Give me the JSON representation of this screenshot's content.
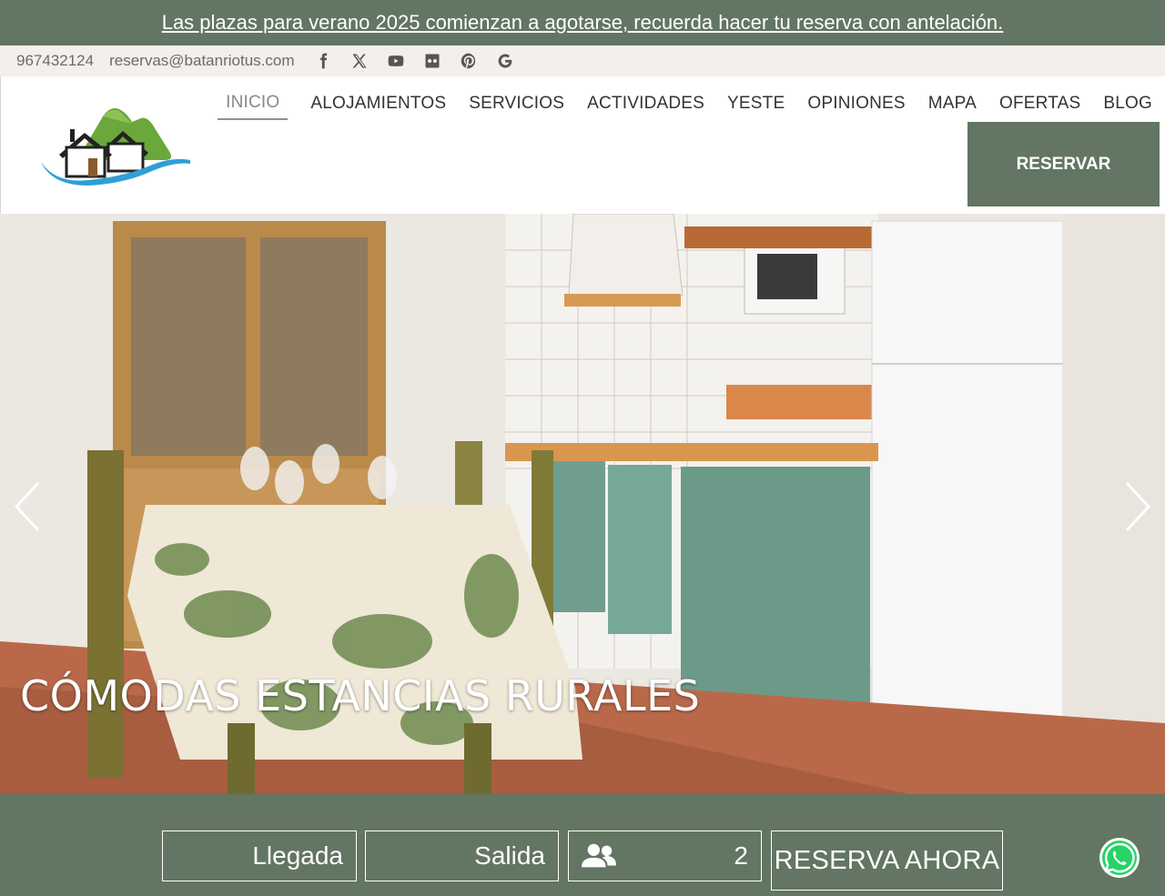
{
  "announcement": {
    "text": "Las plazas para verano 2025 comienzan a agotarse, recuerda hacer tu reserva con antelación."
  },
  "contact": {
    "phone": "967432124",
    "email": "reservas@batanriotus.com",
    "social_icons": [
      "facebook-icon",
      "x-twitter-icon",
      "youtube-icon",
      "flickr-icon",
      "pinterest-icon",
      "google-icon"
    ]
  },
  "nav": {
    "items": [
      {
        "label": "INICIO",
        "active": true
      },
      {
        "label": "ALOJAMIENTOS"
      },
      {
        "label": "SERVICIOS"
      },
      {
        "label": "ACTIVIDADES"
      },
      {
        "label": "YESTE"
      },
      {
        "label": "OPINIONES"
      },
      {
        "label": "MAPA"
      },
      {
        "label": "OFERTAS"
      },
      {
        "label": "BLOG"
      }
    ],
    "reserve_label": "RESERVAR"
  },
  "hero": {
    "title": "CÓMODAS ESTANCIAS RURALES",
    "prev_icon": "chevron-left-icon",
    "next_icon": "chevron-right-icon"
  },
  "booking": {
    "arrival_label": "Llegada",
    "departure_label": "Salida",
    "guests_icon": "users-icon",
    "guests_value": "2",
    "submit_label": "RESERVA AHORA"
  },
  "colors": {
    "brand_green": "#637563",
    "contact_bg": "#f3efea",
    "whatsapp_green": "#25d366"
  }
}
